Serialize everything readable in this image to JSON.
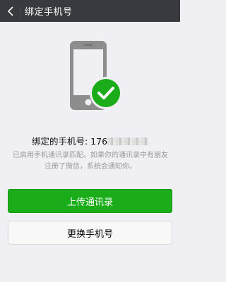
{
  "header": {
    "title": "绑定手机号",
    "back_icon": "chevron-left-icon"
  },
  "status": {
    "label": "绑定的手机号:",
    "phone_visible": "176",
    "phone_masked": true
  },
  "description": "已启用手机通讯录匹配。如果你的通讯录中有朋友注册了微信，系统会通知你。",
  "buttons": {
    "upload_label": "上传通讯录",
    "change_label": "更换手机号"
  },
  "colors": {
    "header_bg": "#393a3f",
    "accent_green": "#1aad19",
    "phone_gray": "#8d8d8d",
    "background": "#efeff4"
  },
  "icons": {
    "illustration": "phone-icon",
    "check": "check-circle-icon"
  }
}
